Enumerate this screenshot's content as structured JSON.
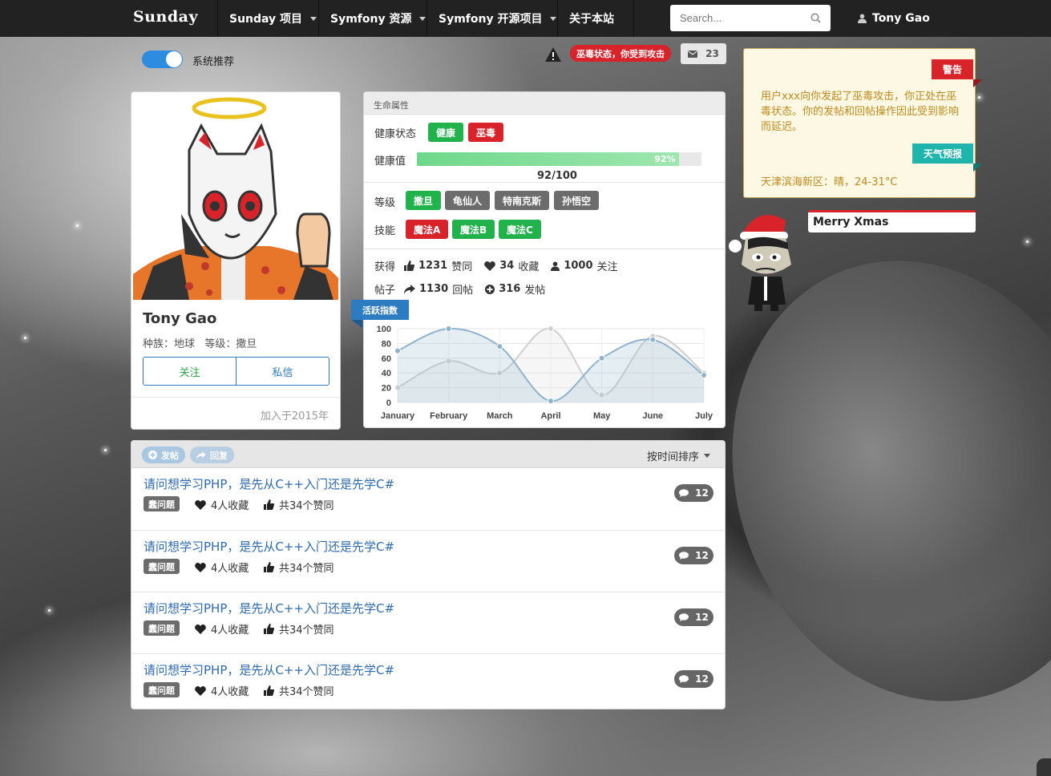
{
  "navbar": {
    "brand": "Sunday",
    "items": [
      {
        "label": "Sunday 项目",
        "dropdown": true
      },
      {
        "label": "Symfony 资源",
        "dropdown": true
      },
      {
        "label": "Symfony 开源项目",
        "dropdown": true
      },
      {
        "label": "关于本站",
        "dropdown": false
      }
    ],
    "search_placeholder": "Search...",
    "user": "Tony Gao"
  },
  "toolbar": {
    "toggle_label": "系统推荐",
    "toggle_on": true,
    "status_alert": "巫毒状态，你受到攻击",
    "mail_count": "23"
  },
  "profile": {
    "name": "Tony Gao",
    "race_label": "种族：地球",
    "level_label": "等级：撒旦",
    "follow_button": "关注",
    "message_button": "私信",
    "joined": "加入于2015年"
  },
  "life": {
    "title": "生命属性",
    "health_status_label": "健康状态",
    "health_tags": [
      {
        "text": "健康",
        "color": "green"
      },
      {
        "text": "巫毒",
        "color": "red"
      }
    ],
    "health_value_label": "健康值",
    "health_percent": 92,
    "health_percent_text": "92%",
    "health_value_text": "92/100",
    "level_label": "等级",
    "level_tags": [
      {
        "text": "撒旦",
        "color": "green"
      },
      {
        "text": "龟仙人",
        "color": "grey"
      },
      {
        "text": "特南克斯",
        "color": "grey"
      },
      {
        "text": "孙悟空",
        "color": "grey"
      }
    ],
    "skill_label": "技能",
    "skill_tags": [
      {
        "text": "魔法A",
        "color": "red"
      },
      {
        "text": "魔法B",
        "color": "green"
      },
      {
        "text": "魔法C",
        "color": "green"
      }
    ],
    "gain_label": "获得",
    "likes": "1231",
    "likes_suffix": "赞同",
    "favorites": "34",
    "favorites_suffix": "收藏",
    "follows": "1000",
    "follows_suffix": "关注",
    "posts_label": "帖子",
    "replies": "1130",
    "replies_suffix": "回帖",
    "threads": "316",
    "threads_suffix": "发帖",
    "activity_ribbon": "活跃指数"
  },
  "chart_data": {
    "type": "line",
    "categories": [
      "January",
      "February",
      "March",
      "April",
      "May",
      "June",
      "July"
    ],
    "series": [
      {
        "values": [
          70,
          100,
          76,
          2,
          60,
          85,
          37
        ],
        "color": "#8fb3cc",
        "fill": "rgba(151,187,205,0.25)"
      },
      {
        "values": [
          20,
          56,
          40,
          100,
          10,
          90,
          40
        ],
        "color": "#cfcfcf",
        "fill": "rgba(220,220,220,0.25)"
      }
    ],
    "ylim": [
      0,
      100
    ],
    "yticks": [
      0,
      20,
      40,
      60,
      80,
      100
    ],
    "grid": true,
    "xlabel": "",
    "ylabel": ""
  },
  "posts": {
    "post_button": "发帖",
    "reply_button": "回复",
    "sort_label": "按时间排序",
    "items": [
      {
        "title": "请问想学习PHP，是先从C++入门还是先学C#",
        "tag": "蠢问题",
        "favorites": "4人收藏",
        "likes": "共34个赞同",
        "count": "12"
      },
      {
        "title": "请问想学习PHP，是先从C++入门还是先学C#",
        "tag": "蠢问题",
        "favorites": "4人收藏",
        "likes": "共34个赞同",
        "count": "12"
      },
      {
        "title": "请问想学习PHP，是先从C++入门还是先学C#",
        "tag": "蠢问题",
        "favorites": "4人收藏",
        "likes": "共34个赞同",
        "count": "12"
      },
      {
        "title": "请问想学习PHP，是先从C++入门还是先学C#",
        "tag": "蠢问题",
        "favorites": "4人收藏",
        "likes": "共34个赞同",
        "count": "12"
      }
    ]
  },
  "alert": {
    "warning_ribbon": "警告",
    "message": "用户xxx向你发起了巫毒攻击，你正处在巫毒状态。你的发帖和回帖操作因此受到影响而延迟。",
    "weather_ribbon": "天气预报",
    "weather": "天津滨海新区：晴，24-31°C"
  },
  "xmas": {
    "text": "Merry Xmas"
  }
}
